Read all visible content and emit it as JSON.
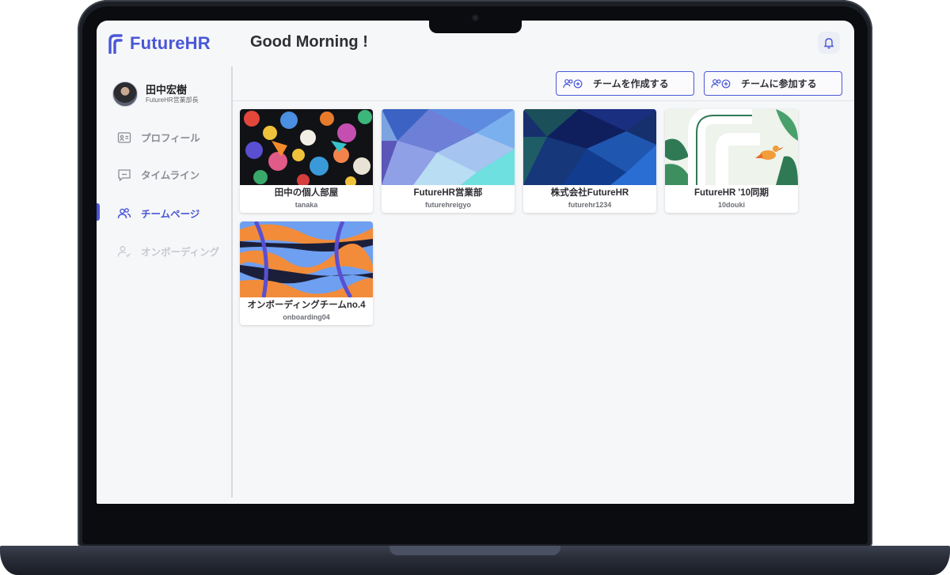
{
  "app": {
    "brand": "FutureHR",
    "accent_color": "#4a57d6"
  },
  "header": {
    "greeting": "Good Morning !",
    "bell_icon": "bell-icon"
  },
  "user": {
    "name": "田中宏樹",
    "role": "FutureHR営業部長"
  },
  "sidebar": {
    "items": [
      {
        "label": "プロフィール",
        "icon": "id-card-icon",
        "state": "normal"
      },
      {
        "label": "タイムライン",
        "icon": "chat-icon",
        "state": "normal"
      },
      {
        "label": "チームページ",
        "icon": "team-icon",
        "state": "active"
      },
      {
        "label": "オンボーディング",
        "icon": "user-check-icon",
        "state": "disabled"
      }
    ]
  },
  "toolbar": {
    "create_team_label": "チームを作成する",
    "join_team_label": "チームに参加する"
  },
  "teams": [
    {
      "name": "田中の個人部屋",
      "id": "tanaka",
      "image": "illustrated-characters"
    },
    {
      "name": "FutureHR営業部",
      "id": "futurehreigyo",
      "image": "blue-low-poly"
    },
    {
      "name": "株式会社FutureHR",
      "id": "futurehr1234",
      "image": "dark-blue-low-poly"
    },
    {
      "name": "FutureHR '10同期",
      "id": "10douki",
      "image": "leaves-logo-bird"
    },
    {
      "name": "オンボーディングチームno.4",
      "id": "onboarding04",
      "image": "wavy-stripes"
    }
  ]
}
